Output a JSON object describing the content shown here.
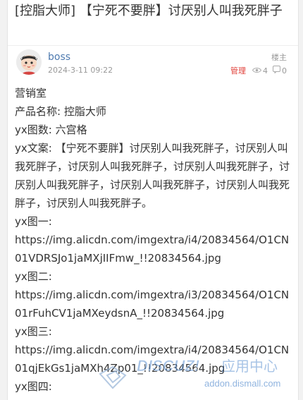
{
  "thread": {
    "title": "[控脂大师] 【宁死不要胖】讨厌别人叫我死胖子"
  },
  "post": {
    "author": "boss",
    "time": "2024-3-11 09:22",
    "floor": "楼主",
    "manage_label": "管理",
    "views": "4",
    "replies": "0",
    "lines": [
      "营销室",
      "产品名称: 控脂大师",
      "yx图数: 六宫格",
      "yx文案: 【宁死不要胖】讨厌别人叫我死胖子，讨厌别人叫我死胖子，讨厌别人叫我死胖子，讨厌别人叫我死胖子，讨厌别人叫我死胖子，讨厌别人叫我死胖子，讨厌别人叫我死胖子，讨厌别人叫我死胖子。",
      "yx图一:",
      "https://img.alicdn.com/imgextra/i4/20834564/O1CN01VDRSJo1jaMXjIIFmw_!!20834564.jpg",
      "yx图二:",
      "https://img.alicdn.com/imgextra/i3/20834564/O1CN01rFuhCV1jaMXeydsnA_!!20834564.jpg",
      "yx图三:",
      "https://img.alicdn.com/imgextra/i4/20834564/O1CN01qjEkGs1jaMXh4Zp01_!!20834564.jpg",
      "yx图四:"
    ]
  },
  "icons": {
    "avatar": "cartoon-avatar-icon",
    "views": "eye-icon",
    "replies": "comment-icon"
  },
  "watermark": {
    "brand": "DISCUZ! 应用中心",
    "site": "addon.dismall.com"
  },
  "colors": {
    "author": "#4f7bb0",
    "manage": "#e0403a",
    "muted": "#999999",
    "text": "#333333",
    "watermark": "#2b6fc2"
  }
}
